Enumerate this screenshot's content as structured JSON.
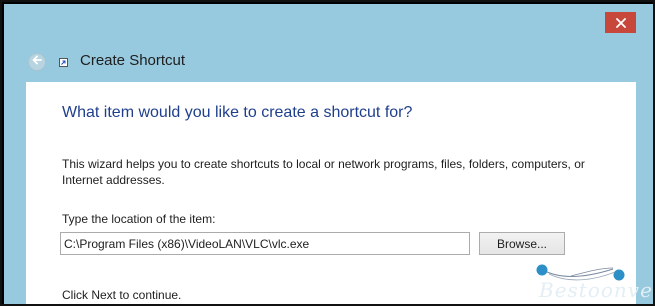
{
  "window": {
    "title": "Create Shortcut",
    "accent_color": "#97c9df",
    "close_button_color": "#c7473a"
  },
  "icons": {
    "back": "back-arrow-icon",
    "close": "close-icon",
    "shortcut": "shortcut-arrow-icon"
  },
  "wizard": {
    "heading": "What item would you like to create a shortcut for?",
    "description": "This wizard helps you to create shortcuts to local or network programs, files, folders, computers, or Internet addresses.",
    "location_label": "Type the location of the item:",
    "location_value": "C:\\Program Files (x86)\\VideoLAN\\VLC\\vlc.exe",
    "browse_label": "Browse...",
    "next_hint": "Click Next to continue."
  },
  "watermark": {
    "text": "Bestoonve"
  }
}
